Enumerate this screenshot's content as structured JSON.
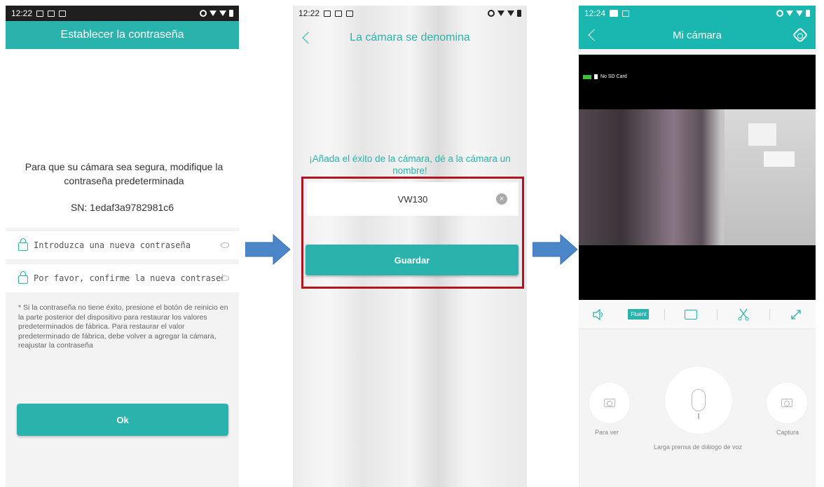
{
  "phone1": {
    "status_time": "12:22",
    "title": "Establecer la contraseña",
    "intro": "Para que su cámara sea segura, modifique la contraseña predeterminada",
    "sn": "SN: 1edaf3a9782981c6",
    "new_password_placeholder": "Introduzca una nueva contraseña",
    "confirm_password_placeholder": "Por favor, confirme la nueva contraseña",
    "note": "* Si la contraseña no tiene éxito, presione el botón de reinicio en la parte posterior del dispositivo para restaurar los valores predeterminados de fábrica. Para restaurar el valor predeterminado de fábrica, debe volver a agregar la cámara, reajustar la contraseña",
    "ok_label": "Ok"
  },
  "phone2": {
    "status_time": "12:22",
    "title": "La cámara se denomina",
    "prompt": "¡Añada el éxito de la cámara, dé a la cámara un nombre!",
    "camera_name": "VW130",
    "save_label": "Guardar"
  },
  "phone3": {
    "status_time": "12:24",
    "title": "Mi cámara",
    "sd_status": "No SD Card",
    "quality_label": "Fluent",
    "view_label": "Para ver",
    "voice_label": "Larga prensa de diálogo de voz",
    "capture_label": "Captura"
  },
  "colors": {
    "accent": "#2ab3ad",
    "highlight_border": "#b1151d",
    "arrow": "#4a86c8"
  }
}
